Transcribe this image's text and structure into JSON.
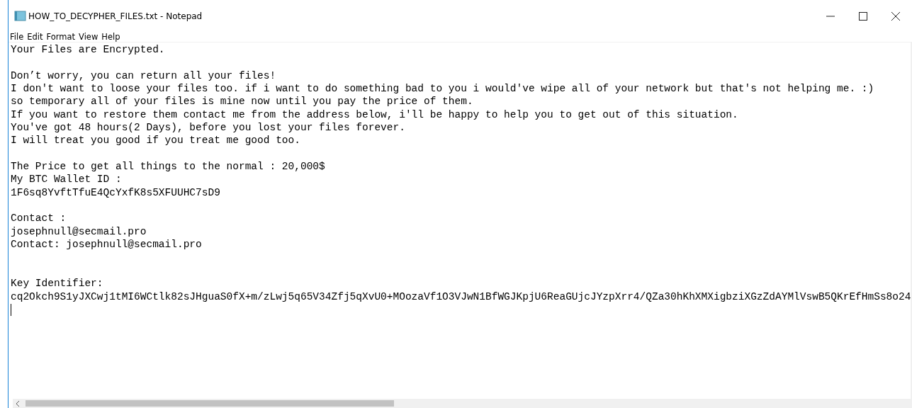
{
  "window": {
    "title": "HOW_TO_DECYPHER_FILES.txt - Notepad"
  },
  "menu": [
    "File",
    "Edit",
    "Format",
    "View",
    "Help"
  ],
  "blocks": [
    {
      "lines": [
        "Your Files are Encrypted."
      ]
    },
    {
      "lines": [
        "Don’t worry, you can return all your files!",
        "I don't want to loose your files too. if i want to do something bad to you i would've wipe all of your network but that's not helping me. :)",
        "so temporary all of your files is mine now until you pay the price of them.",
        "If you want to restore them contact me from the address below, i'll be happy to help you to get out of this situation.",
        "You've got 48 hours(2 Days), before you lost your files forever.",
        "I will treat you good if you treat me good too."
      ]
    },
    {
      "lines": [
        "The Price to get all things to the normal : 20,000$",
        "My BTC Wallet ID :",
        "1F6sq8YvftTfuE4QcYxfK8s5XFUUHC7sD9"
      ]
    },
    {
      "lines": [
        "Contact :",
        "josephnull@secmail.pro",
        "Contact: josephnull@secmail.pro"
      ]
    },
    {
      "lines": [
        "Key Identifier:",
        "cq2Okch9S1yJXCwj1tMI6WCtlk82sJHguaS0fX+m/zLwj5q65V34Zfj5qXvU0+MOozaVf1O3VJwN1BfWGJKpjU6ReaGUjcJYzpXrr4/QZa30hKhXMXigbziXGzZdAYMlVswB5QKrEfHmSs8o24"
      ]
    }
  ]
}
